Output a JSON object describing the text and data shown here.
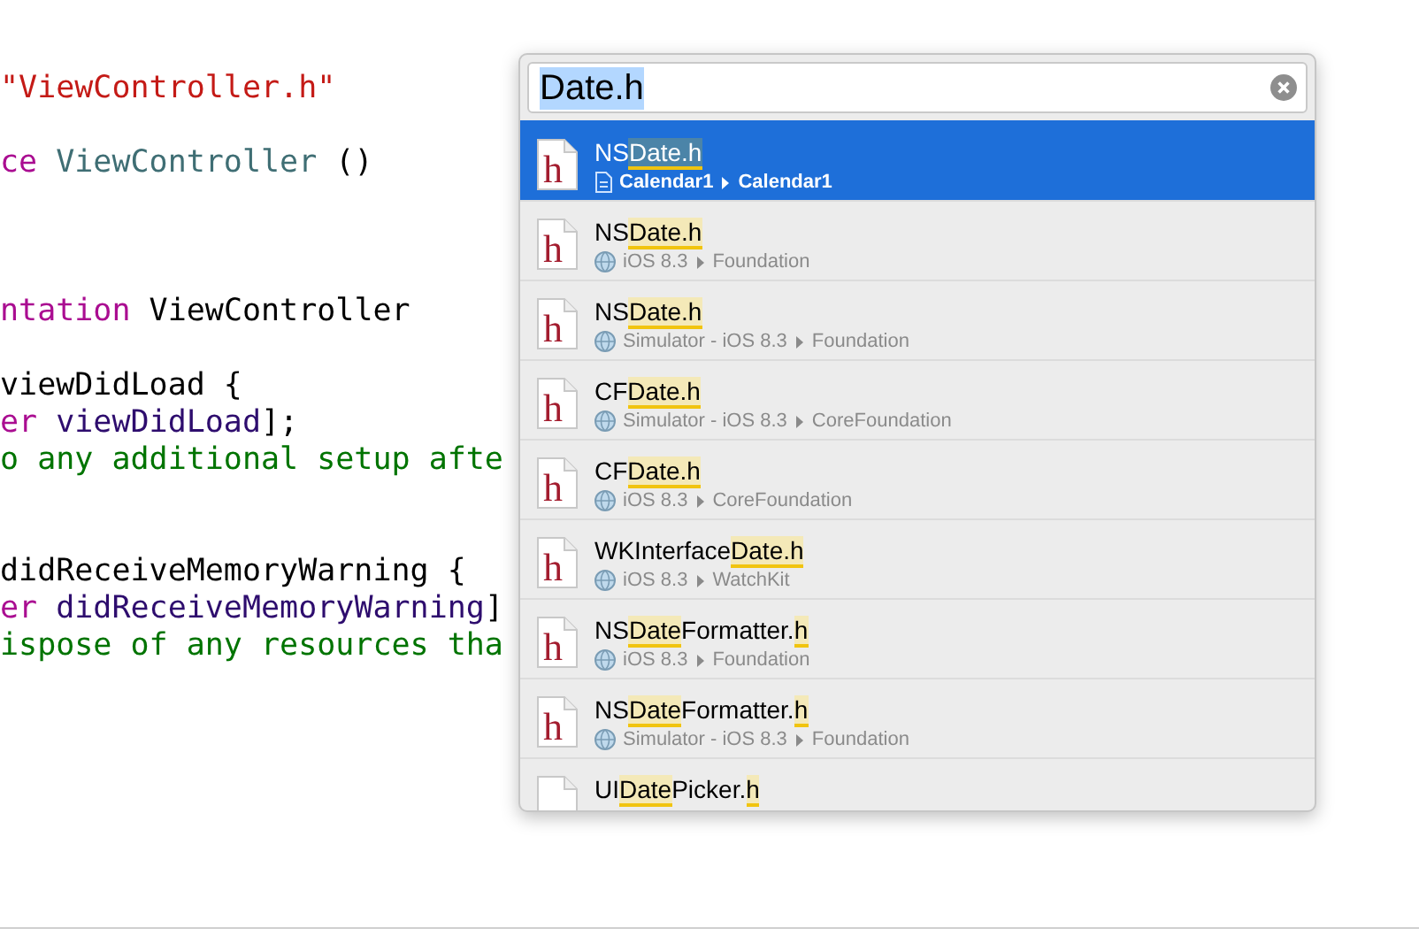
{
  "code_lines": [
    {
      "kind": "code",
      "segments": [
        {
          "kind": "string",
          "text": "\"ViewController.h\""
        }
      ]
    },
    {
      "kind": "blank"
    },
    {
      "kind": "code",
      "segments": [
        {
          "kind": "keyword",
          "text": "ce"
        },
        {
          "kind": "type",
          "text": " ViewController"
        },
        {
          "kind": "plain",
          "text": " ()"
        }
      ]
    },
    {
      "kind": "blank"
    },
    {
      "kind": "blank"
    },
    {
      "kind": "blank"
    },
    {
      "kind": "code",
      "segments": [
        {
          "kind": "keyword",
          "text": "ntation"
        },
        {
          "kind": "plain",
          "text": " ViewController"
        }
      ]
    },
    {
      "kind": "blank"
    },
    {
      "kind": "code",
      "segments": [
        {
          "kind": "plain",
          "text": "viewDidLoad {"
        }
      ]
    },
    {
      "kind": "code",
      "segments": [
        {
          "kind": "keyword",
          "text": "er"
        },
        {
          "kind": "method",
          "text": " viewDidLoad"
        },
        {
          "kind": "plain",
          "text": "];"
        }
      ]
    },
    {
      "kind": "code",
      "segments": [
        {
          "kind": "comment",
          "text": "o any additional setup afte"
        }
      ]
    },
    {
      "kind": "blank"
    },
    {
      "kind": "blank"
    },
    {
      "kind": "code",
      "segments": [
        {
          "kind": "plain",
          "text": "didReceiveMemoryWarning {"
        }
      ]
    },
    {
      "kind": "code",
      "segments": [
        {
          "kind": "keyword",
          "text": "er"
        },
        {
          "kind": "method",
          "text": " didReceiveMemoryWarning"
        },
        {
          "kind": "plain",
          "text": "]"
        }
      ]
    },
    {
      "kind": "code",
      "segments": [
        {
          "kind": "comment",
          "text": "ispose of any resources tha"
        }
      ]
    }
  ],
  "quick_open": {
    "search": {
      "value": "Date.h",
      "text_selected": true
    },
    "results": [
      {
        "selected": true,
        "icon_glyph": "h",
        "title": [
          {
            "text": "NS",
            "match": false
          },
          {
            "text": "Date.h",
            "match": true
          }
        ],
        "kind": "project",
        "path": [
          "Calendar1",
          "Calendar1"
        ]
      },
      {
        "selected": false,
        "icon_glyph": "h",
        "title": [
          {
            "text": "NS",
            "match": false
          },
          {
            "text": "Date.h",
            "match": true
          }
        ],
        "kind": "sdk",
        "path": [
          "iOS 8.3",
          "Foundation"
        ]
      },
      {
        "selected": false,
        "icon_glyph": "h",
        "title": [
          {
            "text": "NS",
            "match": false
          },
          {
            "text": "Date.h",
            "match": true
          }
        ],
        "kind": "sdk",
        "path": [
          "Simulator - iOS 8.3",
          "Foundation"
        ]
      },
      {
        "selected": false,
        "icon_glyph": "h",
        "title": [
          {
            "text": "CF",
            "match": false
          },
          {
            "text": "Date.h",
            "match": true
          }
        ],
        "kind": "sdk",
        "path": [
          "Simulator - iOS 8.3",
          "CoreFoundation"
        ]
      },
      {
        "selected": false,
        "icon_glyph": "h",
        "title": [
          {
            "text": "CF",
            "match": false
          },
          {
            "text": "Date.h",
            "match": true
          }
        ],
        "kind": "sdk",
        "path": [
          "iOS 8.3",
          "CoreFoundation"
        ]
      },
      {
        "selected": false,
        "icon_glyph": "h",
        "title": [
          {
            "text": "WKInterface",
            "match": false
          },
          {
            "text": "Date.h",
            "match": true
          }
        ],
        "kind": "sdk",
        "path": [
          "iOS 8.3",
          "WatchKit"
        ]
      },
      {
        "selected": false,
        "icon_glyph": "h",
        "title": [
          {
            "text": "NS",
            "match": false
          },
          {
            "text": "Date",
            "match": true
          },
          {
            "text": "Formatter.",
            "match": false
          },
          {
            "text": "h",
            "match": true
          }
        ],
        "kind": "sdk",
        "path": [
          "iOS 8.3",
          "Foundation"
        ]
      },
      {
        "selected": false,
        "icon_glyph": "h",
        "title": [
          {
            "text": "NS",
            "match": false
          },
          {
            "text": "Date",
            "match": true
          },
          {
            "text": "Formatter.",
            "match": false
          },
          {
            "text": "h",
            "match": true
          }
        ],
        "kind": "sdk",
        "path": [
          "Simulator - iOS 8.3",
          "Foundation"
        ]
      },
      {
        "selected": false,
        "title": [
          {
            "text": "UI",
            "match": false
          },
          {
            "text": "Date",
            "match": true
          },
          {
            "text": "Picker.",
            "match": false
          },
          {
            "text": "h",
            "match": true
          }
        ]
      }
    ]
  }
}
